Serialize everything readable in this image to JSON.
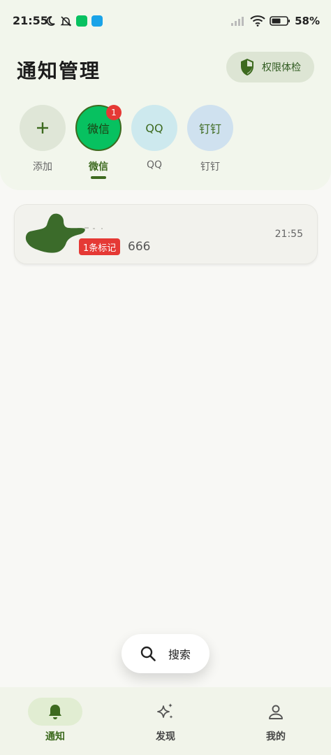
{
  "status_bar": {
    "time": "21:55",
    "battery": "58%",
    "left_icons": [
      "moon-icon",
      "bell-off-icon",
      "wechat-app-icon",
      "upload-app-icon"
    ],
    "right_icons": [
      "cellular-signal-icon",
      "wifi-icon",
      "battery-icon"
    ]
  },
  "header": {
    "title": "通知管理",
    "permission_button_label": "权限体检",
    "permission_icon": "shield-icon"
  },
  "apps": [
    {
      "circle_text": "+",
      "label": "添加",
      "bg": "#dfe6d7",
      "fg": "#3d6a1f",
      "active": false
    },
    {
      "circle_text": "微信",
      "label": "微信",
      "bg": "#07c160",
      "fg": "#1f3a10",
      "active": true,
      "badge": "1"
    },
    {
      "circle_text": "QQ",
      "label": "QQ",
      "bg": "#cde9ee",
      "fg": "#3d6a1f",
      "active": false
    },
    {
      "circle_text": "钉钉",
      "label": "钉钉",
      "bg": "#cfe1ef",
      "fg": "#3d6a1f",
      "active": false
    }
  ],
  "messages": [
    {
      "tag": "1条标记",
      "text": "666",
      "time": "21:55"
    }
  ],
  "search": {
    "label": "搜索"
  },
  "bottom_nav": [
    {
      "label": "通知",
      "icon": "bell-icon",
      "active": true
    },
    {
      "label": "发现",
      "icon": "sparkle-icon",
      "active": false
    },
    {
      "label": "我的",
      "icon": "person-icon",
      "active": false
    }
  ],
  "colors": {
    "accent": "#3d6a1f",
    "header_bg": "#f2f6ec",
    "badge_red": "#e53935",
    "wechat_green": "#07c160"
  }
}
